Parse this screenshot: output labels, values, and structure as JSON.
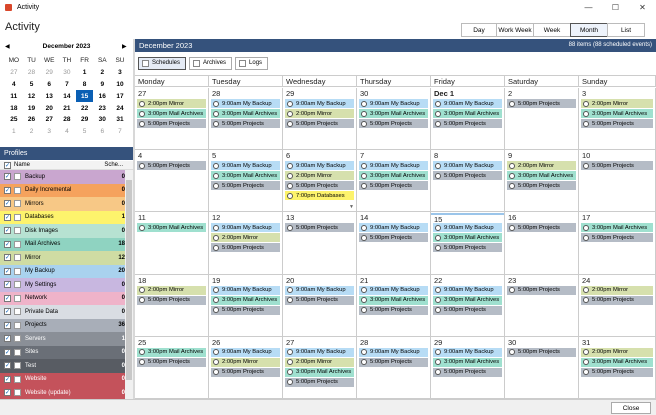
{
  "window": {
    "title": "Activity",
    "minimize": "—",
    "maximize": "☐",
    "close": "✕"
  },
  "heading": "Activity",
  "views": [
    "Day",
    "Work Week",
    "Week",
    "Month",
    "List"
  ],
  "active_view": "Month",
  "mini_calendar": {
    "title": "December 2023",
    "prev": "◀",
    "next": "▶",
    "dow": [
      "MO",
      "TU",
      "WE",
      "TH",
      "FR",
      "SA",
      "SU"
    ],
    "weeks": [
      [
        "27",
        "28",
        "29",
        "30",
        "1",
        "2",
        "3"
      ],
      [
        "4",
        "5",
        "6",
        "7",
        "8",
        "9",
        "10"
      ],
      [
        "11",
        "12",
        "13",
        "14",
        "15",
        "16",
        "17"
      ],
      [
        "18",
        "19",
        "20",
        "21",
        "22",
        "23",
        "24"
      ],
      [
        "25",
        "26",
        "27",
        "28",
        "29",
        "30",
        "31"
      ],
      [
        "1",
        "2",
        "3",
        "4",
        "5",
        "6",
        "7"
      ]
    ],
    "today": "15"
  },
  "profiles": {
    "title": "Profiles",
    "col_name": "Name",
    "col_count": "Sche...",
    "items": [
      {
        "name": "Backup",
        "count": "0",
        "color": "#c9a6cf"
      },
      {
        "name": "Daily Incremental",
        "count": "0",
        "color": "#f5a25d"
      },
      {
        "name": "Mirrors",
        "count": "0",
        "color": "#f7c886"
      },
      {
        "name": "Databases",
        "count": "1",
        "color": "#fdf36c"
      },
      {
        "name": "Disk Images",
        "count": "0",
        "color": "#b7e2d2"
      },
      {
        "name": "Mail Archives",
        "count": "18",
        "color": "#8fd3c1"
      },
      {
        "name": "Mirror",
        "count": "12",
        "color": "#cfdca3"
      },
      {
        "name": "My Backup",
        "count": "20",
        "color": "#a9d2ee"
      },
      {
        "name": "My Settings",
        "count": "0",
        "color": "#c8b7e0"
      },
      {
        "name": "Network",
        "count": "0",
        "color": "#efb3c9"
      },
      {
        "name": "Private Data",
        "count": "0",
        "color": "#d9dde3"
      },
      {
        "name": "Projects",
        "count": "36",
        "color": "#a8aeb8"
      },
      {
        "name": "Servers",
        "count": "1",
        "color": "#8a8f97"
      },
      {
        "name": "Sites",
        "count": "0",
        "color": "#6a6f77"
      },
      {
        "name": "Test",
        "count": "0",
        "color": "#585c63"
      },
      {
        "name": "Website",
        "count": "0",
        "color": "#c4525b"
      },
      {
        "name": "Website (update)",
        "count": "0",
        "color": "#c4525b"
      }
    ]
  },
  "main": {
    "month_title": "December 2023",
    "count_text": "88 items (88 scheduled events)",
    "filters": [
      "Schedules",
      "Archives",
      "Logs"
    ],
    "active_filter": "Schedules",
    "dow": [
      "Monday",
      "Tuesday",
      "Wednesday",
      "Thursday",
      "Friday",
      "Saturday",
      "Sunday"
    ]
  },
  "colors": {
    "mirror": "#d6e0ad",
    "mail": "#9fe0cf",
    "projects": "#b5bcc6",
    "backup": "#b7dcf5",
    "databases": "#fdf36c",
    "header": "#35527c"
  },
  "weeks": [
    [
      {
        "day": "27",
        "events": [
          {
            "t": "2:00pm Mirror",
            "k": "mirror"
          },
          {
            "t": "3:00pm Mail Archives",
            "k": "mail"
          },
          {
            "t": "5:00pm Projects",
            "k": "projects"
          }
        ]
      },
      {
        "day": "28",
        "events": [
          {
            "t": "9:00am My Backup",
            "k": "backup"
          },
          {
            "t": "3:00pm Mail Archives",
            "k": "mail"
          },
          {
            "t": "5:00pm Projects",
            "k": "projects"
          }
        ]
      },
      {
        "day": "29",
        "events": [
          {
            "t": "9:00am My Backup",
            "k": "backup"
          },
          {
            "t": "2:00pm Mirror",
            "k": "mirror"
          },
          {
            "t": "5:00pm Projects",
            "k": "projects"
          }
        ]
      },
      {
        "day": "30",
        "events": [
          {
            "t": "9:00am My Backup",
            "k": "backup"
          },
          {
            "t": "3:00pm Mail Archives",
            "k": "mail"
          },
          {
            "t": "5:00pm Projects",
            "k": "projects"
          }
        ]
      },
      {
        "day": "Dec 1",
        "bold": true,
        "events": [
          {
            "t": "9:00am My Backup",
            "k": "backup"
          },
          {
            "t": "3:00pm Mail Archives",
            "k": "mail"
          },
          {
            "t": "5:00pm Projects",
            "k": "projects"
          }
        ]
      },
      {
        "day": "2",
        "events": [
          {
            "t": "5:00pm Projects",
            "k": "projects"
          }
        ]
      },
      {
        "day": "3",
        "events": [
          {
            "t": "2:00pm Mirror",
            "k": "mirror"
          },
          {
            "t": "3:00pm Mail Archives",
            "k": "mail"
          },
          {
            "t": "5:00pm Projects",
            "k": "projects"
          }
        ]
      }
    ],
    [
      {
        "day": "4",
        "events": [
          {
            "t": "5:00pm Projects",
            "k": "projects"
          }
        ]
      },
      {
        "day": "5",
        "events": [
          {
            "t": "9:00am My Backup",
            "k": "backup"
          },
          {
            "t": "3:00pm Mail Archives",
            "k": "mail"
          },
          {
            "t": "5:00pm Projects",
            "k": "projects"
          }
        ]
      },
      {
        "day": "6",
        "more": "▼",
        "events": [
          {
            "t": "9:00am My Backup",
            "k": "backup"
          },
          {
            "t": "2:00pm Mirror",
            "k": "mirror"
          },
          {
            "t": "5:00pm Projects",
            "k": "projects"
          },
          {
            "t": "7:00pm Databases",
            "k": "databases"
          }
        ]
      },
      {
        "day": "7",
        "events": [
          {
            "t": "9:00am My Backup",
            "k": "backup"
          },
          {
            "t": "3:00pm Mail Archives",
            "k": "mail"
          },
          {
            "t": "5:00pm Projects",
            "k": "projects"
          }
        ]
      },
      {
        "day": "8",
        "events": [
          {
            "t": "9:00am My Backup",
            "k": "backup"
          },
          {
            "t": "5:00pm Projects",
            "k": "projects"
          }
        ]
      },
      {
        "day": "9",
        "events": [
          {
            "t": "2:00pm Mirror",
            "k": "mirror"
          },
          {
            "t": "3:00pm Mail Archives",
            "k": "mail"
          },
          {
            "t": "5:00pm Projects",
            "k": "projects"
          }
        ]
      },
      {
        "day": "10",
        "events": [
          {
            "t": "5:00pm Projects",
            "k": "projects"
          }
        ]
      }
    ],
    [
      {
        "day": "11",
        "events": [
          {
            "t": "3:00pm Mail Archives",
            "k": "mail"
          }
        ]
      },
      {
        "day": "12",
        "events": [
          {
            "t": "9:00am My Backup",
            "k": "backup"
          },
          {
            "t": "2:00pm Mirror",
            "k": "mirror"
          },
          {
            "t": "5:00pm Projects",
            "k": "projects"
          }
        ]
      },
      {
        "day": "13",
        "events": [
          {
            "t": "5:00pm Projects",
            "k": "projects"
          }
        ]
      },
      {
        "day": "14",
        "events": [
          {
            "t": "9:00am My Backup",
            "k": "backup"
          },
          {
            "t": "5:00pm Projects",
            "k": "projects"
          }
        ]
      },
      {
        "day": "15",
        "today": true,
        "events": [
          {
            "t": "9:00am My Backup",
            "k": "backup"
          },
          {
            "t": "3:00pm Mail Archives",
            "k": "mail"
          },
          {
            "t": "5:00pm Projects",
            "k": "projects"
          }
        ]
      },
      {
        "day": "16",
        "events": [
          {
            "t": "5:00pm Projects",
            "k": "projects"
          }
        ]
      },
      {
        "day": "17",
        "events": [
          {
            "t": "3:00pm Mail Archives",
            "k": "mail"
          },
          {
            "t": "5:00pm Projects",
            "k": "projects"
          }
        ]
      }
    ],
    [
      {
        "day": "18",
        "events": [
          {
            "t": "2:00pm Mirror",
            "k": "mirror"
          },
          {
            "t": "5:00pm Projects",
            "k": "projects"
          }
        ]
      },
      {
        "day": "19",
        "events": [
          {
            "t": "9:00am My Backup",
            "k": "backup"
          },
          {
            "t": "3:00pm Mail Archives",
            "k": "mail"
          },
          {
            "t": "5:00pm Projects",
            "k": "projects"
          }
        ]
      },
      {
        "day": "20",
        "events": [
          {
            "t": "9:00am My Backup",
            "k": "backup"
          },
          {
            "t": "5:00pm Projects",
            "k": "projects"
          }
        ]
      },
      {
        "day": "21",
        "events": [
          {
            "t": "9:00am My Backup",
            "k": "backup"
          },
          {
            "t": "3:00pm Mail Archives",
            "k": "mail"
          },
          {
            "t": "5:00pm Projects",
            "k": "projects"
          }
        ]
      },
      {
        "day": "22",
        "events": [
          {
            "t": "9:00am My Backup",
            "k": "backup"
          },
          {
            "t": "3:00pm Mail Archives",
            "k": "mail"
          },
          {
            "t": "5:00pm Projects",
            "k": "projects"
          }
        ]
      },
      {
        "day": "23",
        "events": [
          {
            "t": "5:00pm Projects",
            "k": "projects"
          }
        ]
      },
      {
        "day": "24",
        "events": [
          {
            "t": "2:00pm Mirror",
            "k": "mirror"
          },
          {
            "t": "5:00pm Projects",
            "k": "projects"
          }
        ]
      }
    ],
    [
      {
        "day": "25",
        "events": [
          {
            "t": "3:00pm Mail Archives",
            "k": "mail"
          },
          {
            "t": "5:00pm Projects",
            "k": "projects"
          }
        ]
      },
      {
        "day": "26",
        "events": [
          {
            "t": "9:00am My Backup",
            "k": "backup"
          },
          {
            "t": "2:00pm Mirror",
            "k": "mirror"
          },
          {
            "t": "5:00pm Projects",
            "k": "projects"
          }
        ]
      },
      {
        "day": "27",
        "events": [
          {
            "t": "9:00am My Backup",
            "k": "backup"
          },
          {
            "t": "2:00pm Mirror",
            "k": "mirror"
          },
          {
            "t": "3:00pm Mail Archives",
            "k": "mail"
          },
          {
            "t": "5:00pm Projects",
            "k": "projects"
          }
        ]
      },
      {
        "day": "28",
        "events": [
          {
            "t": "9:00am My Backup",
            "k": "backup"
          },
          {
            "t": "5:00pm Projects",
            "k": "projects"
          }
        ]
      },
      {
        "day": "29",
        "events": [
          {
            "t": "9:00am My Backup",
            "k": "backup"
          },
          {
            "t": "3:00pm Mail Archives",
            "k": "mail"
          },
          {
            "t": "5:00pm Projects",
            "k": "projects"
          }
        ]
      },
      {
        "day": "30",
        "events": [
          {
            "t": "5:00pm Projects",
            "k": "projects"
          }
        ]
      },
      {
        "day": "31",
        "events": [
          {
            "t": "2:00pm Mirror",
            "k": "mirror"
          },
          {
            "t": "3:00pm Mail Archives",
            "k": "mail"
          },
          {
            "t": "5:00pm Projects",
            "k": "projects"
          }
        ]
      }
    ]
  ],
  "footer": {
    "close": "Close"
  }
}
